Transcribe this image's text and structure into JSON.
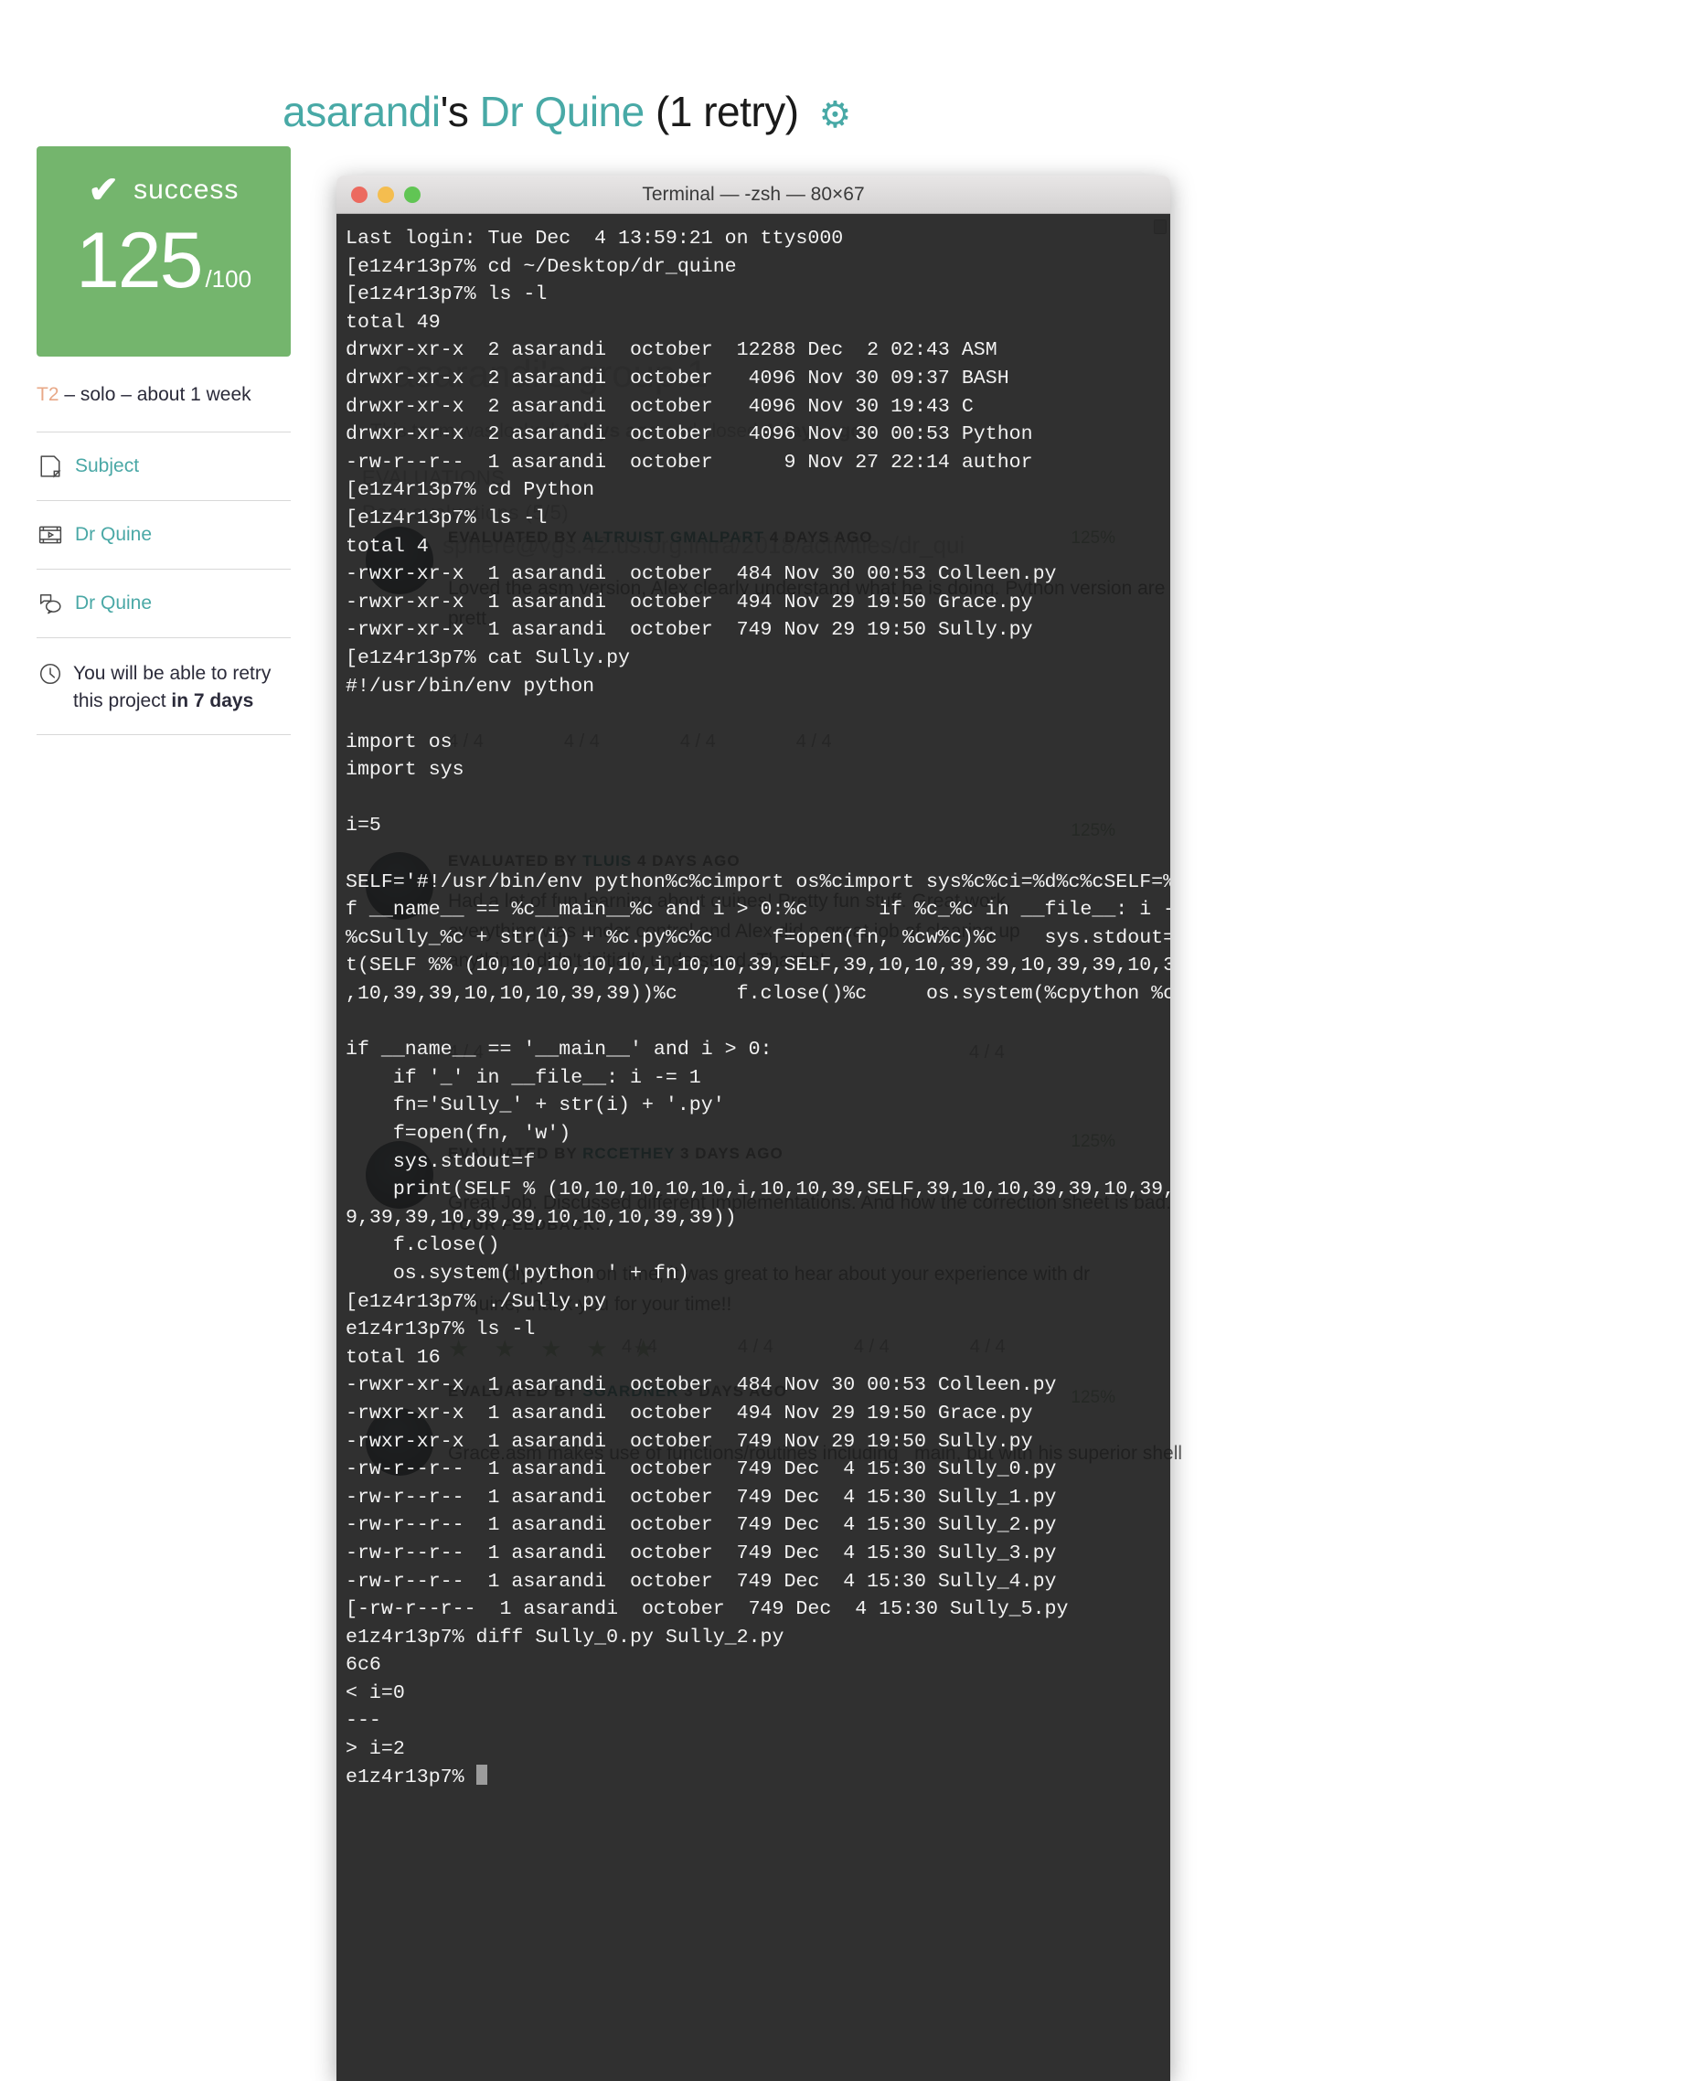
{
  "header": {
    "user": "asarandi",
    "possessive": "'s",
    "project": " Dr Quine ",
    "retry": "(1 retry)",
    "gear": "gear-icon"
  },
  "sidebar": {
    "card": {
      "check": "✔",
      "status": "success",
      "score": "125",
      "total": "/100",
      "bg_color": "#74b56d"
    },
    "meta": {
      "team_tag": "T2",
      "rest": " – solo – about 1 week"
    },
    "items": [
      {
        "icon": "document-icon",
        "label": "Subject"
      },
      {
        "icon": "video-icon",
        "label": "Dr Quine"
      },
      {
        "icon": "chat-icon",
        "label": "Dr Quine"
      }
    ],
    "retry_note": {
      "icon": "clock-icon",
      "text_before": "You will be able to retry this project ",
      "text_bold": "in 7 days"
    }
  },
  "terminal": {
    "title": "Terminal — -zsh — 80×67",
    "lights": [
      "close-button",
      "minimize-button",
      "zoom-button"
    ],
    "content": "Last login: Tue Dec  4 13:59:21 on ttys000\n[e1z4r13p7% cd ~/Desktop/dr_quine\n[e1z4r13p7% ls -l\ntotal 49\ndrwxr-xr-x  2 asarandi  october  12288 Dec  2 02:43 ASM\ndrwxr-xr-x  2 asarandi  october   4096 Nov 30 09:37 BASH\ndrwxr-xr-x  2 asarandi  october   4096 Nov 30 19:43 C\ndrwxr-xr-x  2 asarandi  october   4096 Nov 30 00:53 Python\n-rw-r--r--  1 asarandi  october      9 Nov 27 22:14 author\n[e1z4r13p7% cd Python\n[e1z4r13p7% ls -l\ntotal 4\n-rwxr-xr-x  1 asarandi  october  484 Nov 30 00:53 Colleen.py\n-rwxr-xr-x  1 asarandi  october  494 Nov 29 19:50 Grace.py\n-rwxr-xr-x  1 asarandi  october  749 Nov 29 19:50 Sully.py\n[e1z4r13p7% cat Sully.py\n#!/usr/bin/env python\n\nimport os\nimport sys\n\ni=5\n\nSELF='#!/usr/bin/env python%c%cimport os%cimport sys%c%ci=%d%c%cSELF=%c%s%c%c%ci\nf __name__ == %c__main__%c and i > 0:%c      if %c_%c in __file__: i -= 1%c     fn=\n%cSully_%c + str(i) + %c.py%c%c     f=open(fn, %cw%c)%c    sys.stdout=f%c     prin\nt(SELF %% (10,10,10,10,10,i,10,10,39,SELF,39,10,10,39,39,10,39,39,10,39,39,39,39\n,10,39,39,10,10,10,39,39))%c     f.close()%c     os.system(%cpython %c + fn)'\n\nif __name__ == '__main__' and i > 0:\n    if '_' in __file__: i -= 1\n    fn='Sully_' + str(i) + '.py'\n    f=open(fn, 'w')\n    sys.stdout=f\n    print(SELF % (10,10,10,10,10,i,10,10,39,SELF,39,10,10,39,39,10,39,39,10,39,3\n9,39,39,10,39,39,10,10,10,39,39))\n    f.close()\n    os.system('python ' + fn)\n[e1z4r13p7% ./Sully.py\ne1z4r13p7% ls -l\ntotal 16\n-rwxr-xr-x  1 asarandi  october  484 Nov 30 00:53 Colleen.py\n-rwxr-xr-x  1 asarandi  october  494 Nov 29 19:50 Grace.py\n-rwxr-xr-x  1 asarandi  october  749 Nov 29 19:50 Sully.py\n-rw-r--r--  1 asarandi  october  749 Dec  4 15:30 Sully_0.py\n-rw-r--r--  1 asarandi  october  749 Dec  4 15:30 Sully_1.py\n-rw-r--r--  1 asarandi  october  749 Dec  4 15:30 Sully_2.py\n-rw-r--r--  1 asarandi  october  749 Dec  4 15:30 Sully_3.py\n-rw-r--r--  1 asarandi  october  749 Dec  4 15:30 Sully_4.py\n[-rw-r--r--  1 asarandi  october  749 Dec  4 15:30 Sully_5.py\ne1z4r13p7% diff Sully_0.py Sully_2.py\n6c6\n< i=0\n---\n> i=2\ne1z4r13p7% "
  },
  "intra": {
    "team_title": "asarandi's group 1",
    "team_sub_before": "This team was locked ",
    "team_sub_bold1": "4 days ago",
    "team_sub_mid": " and closed ",
    "team_sub_bold2": "4 days ago",
    "repo": "sphere@vgs.42.us.org:intra/2018/activities/dr_qui",
    "evaluations_label": "EVALUATIONS",
    "peer_label": "Peer evaluations (5/5)",
    "pct_marks": [
      "125%",
      "125%",
      "125%",
      "125%",
      "125%",
      "125%"
    ],
    "evals": [
      {
        "head_prefix": "EVALUATED BY ",
        "who": "ALTRUIST GMALPART",
        "when": " 4 DAYS AGO",
        "pct": "125%",
        "text": "Loved the asm version, Alex clearly understand what he is doing. Python version are prett"
      },
      {
        "head_prefix": "EVALUATED BY ",
        "who": "TLUIS",
        "when": " 4 DAYS AGO",
        "pct": "125%",
        "text": "Had a lot of fun learning about quines! Pretty fun stuff. Great work, everything was under control and Alex did a great job of clearing up anything I didn't initially understand. Thanks!"
      },
      {
        "head_prefix": "EVALUATED BY ",
        "who": "RCCETHEY",
        "when": " 3 DAYS AGO",
        "pct": "125%",
        "text": "Great Job. Discussed different implementations. And how the correction sheet is bad."
      },
      {
        "head_prefix": "EVALUATED BY ",
        "who": "SGARDNER",
        "when": " 3 DAYS AGO",
        "pct": "125%",
        "text": "Grace.asm makes use of functions/routines including _main, but with his superior shell"
      }
    ],
    "feedback_label": "YOUR FEEDBACK:",
    "feedback_text": "friendly, polite, on time, it was great to hear about your experience with dr quine; thank you for your time!!",
    "metric_scores": [
      "4 / 4",
      "4 / 4",
      "4 / 4",
      "4 / 4"
    ],
    "stars": "★ ★ ★ ★ ★"
  }
}
